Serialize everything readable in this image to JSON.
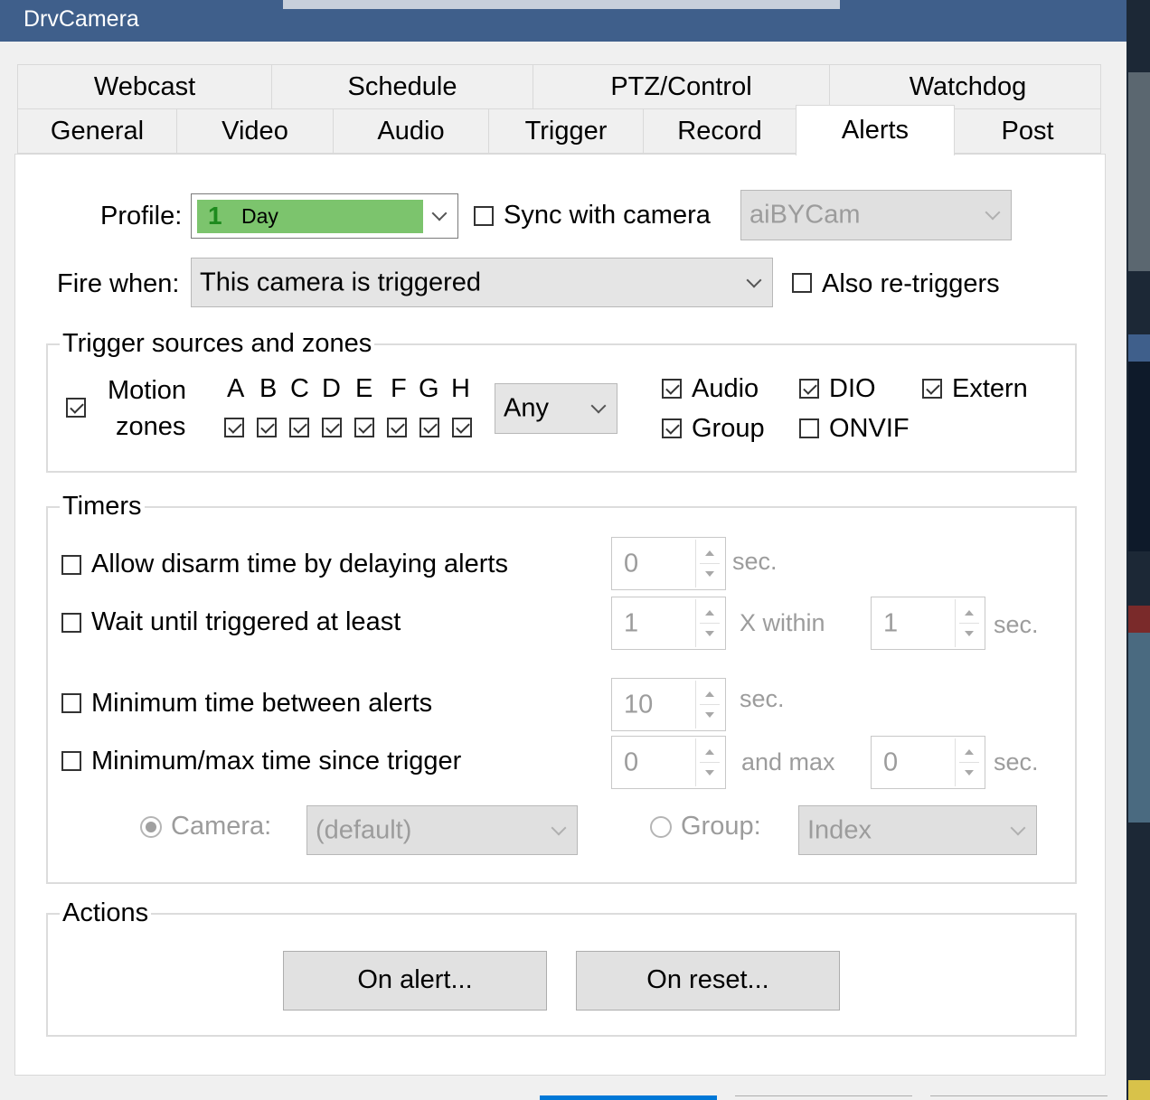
{
  "window": {
    "title": "DrvCamera"
  },
  "tabs_row1": [
    "Webcast",
    "Schedule",
    "PTZ/Control",
    "Watchdog"
  ],
  "tabs_row2": [
    "General",
    "Video",
    "Audio",
    "Trigger",
    "Record",
    "Alerts",
    "Post"
  ],
  "active_tab": "Alerts",
  "profile": {
    "label": "Profile:",
    "number": "1",
    "value": "Day",
    "color": "#7cc46d"
  },
  "sync": {
    "label": "Sync with camera",
    "checked": false,
    "camera_value": "aiBYCam"
  },
  "fire": {
    "label": "Fire when:",
    "value": "This camera is triggered"
  },
  "also_retrigger": {
    "label": "Also re-triggers",
    "checked": false
  },
  "trigger_sources": {
    "title": "Trigger sources and zones",
    "motion_label_line1": "Motion",
    "motion_label_line2": "zones",
    "motion_checked": true,
    "zones": [
      "A",
      "B",
      "C",
      "D",
      "E",
      "F",
      "G",
      "H"
    ],
    "zone_mode": "Any",
    "sources": [
      {
        "label": "Audio",
        "checked": true
      },
      {
        "label": "DIO",
        "checked": true
      },
      {
        "label": "Extern",
        "checked": true
      },
      {
        "label": "Group",
        "checked": true
      },
      {
        "label": "ONVIF",
        "checked": false
      }
    ]
  },
  "timers": {
    "title": "Timers",
    "disarm": {
      "label": "Allow disarm time by delaying alerts",
      "value": "0",
      "unit": "sec."
    },
    "wait": {
      "label": "Wait until triggered at least",
      "value": "1",
      "within_label": "X within",
      "within_value": "1",
      "unit": "sec."
    },
    "min_between": {
      "label": "Minimum time between alerts",
      "value": "10",
      "unit": "sec."
    },
    "min_max": {
      "label": "Minimum/max time since trigger",
      "value": "0",
      "max_label": "and max",
      "max_value": "0",
      "unit": "sec."
    },
    "camera_label": "Camera:",
    "camera_value": "(default)",
    "group_label": "Group:",
    "group_value": "Index"
  },
  "actions": {
    "title": "Actions",
    "on_alert": "On alert...",
    "on_reset": "On reset..."
  }
}
